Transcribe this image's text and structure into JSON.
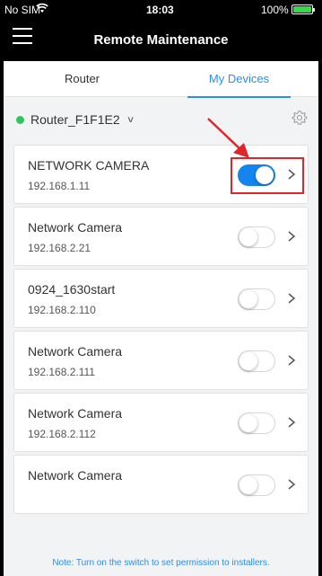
{
  "status_bar": {
    "carrier": "No SIM",
    "time": "18:03",
    "battery_percent": "100%",
    "battery_level": 1.0,
    "battery_color": "#38d84b"
  },
  "nav": {
    "title": "Remote Maintenance",
    "menu_icon": "hamburger-menu-icon"
  },
  "tabs": [
    {
      "label": "Router",
      "active": false
    },
    {
      "label": "My Devices",
      "active": true
    }
  ],
  "router": {
    "name": "Router_F1F1E2",
    "status_color": "#2ec55c",
    "settings_icon": "gear-icon"
  },
  "devices": [
    {
      "name": "NETWORK CAMERA",
      "ip": "192.168.1.11",
      "enabled": true
    },
    {
      "name": "Network Camera",
      "ip": "192.168.2.21",
      "enabled": false
    },
    {
      "name": "0924_1630start",
      "ip": "192.168.2.110",
      "enabled": false
    },
    {
      "name": "Network Camera",
      "ip": "192.168.2.111",
      "enabled": false
    },
    {
      "name": "Network Camera",
      "ip": "192.168.2.112",
      "enabled": false
    },
    {
      "name": "Network Camera",
      "ip": "",
      "enabled": false
    }
  ],
  "note": "Note: Turn on the switch to set permission to installers.",
  "colors": {
    "accent": "#2a8ef0",
    "toggle_on": "#1485ee",
    "annotation": "#e0262b"
  }
}
